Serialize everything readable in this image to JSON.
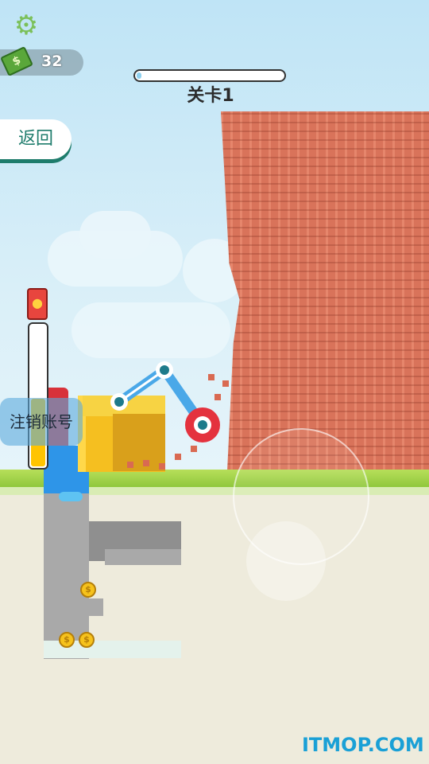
{
  "hud": {
    "money_value": "32",
    "money_icon": "cash-icon",
    "settings_icon": "gear-icon",
    "level_label": "关卡1",
    "level_progress": 0.02
  },
  "buttons": {
    "back_label": "返回",
    "logout_label": "注销账号"
  },
  "fuel": {
    "icon": "fuel-can-icon",
    "level": 0.48
  },
  "watermark": "ITMOP.COM",
  "colors": {
    "brick": "#d9735a",
    "machine": "#2e95e8",
    "arm": "#4aa8e8",
    "saw": "#e4323e",
    "grass": "#9bd04a",
    "accent": "#1e7c6c"
  }
}
